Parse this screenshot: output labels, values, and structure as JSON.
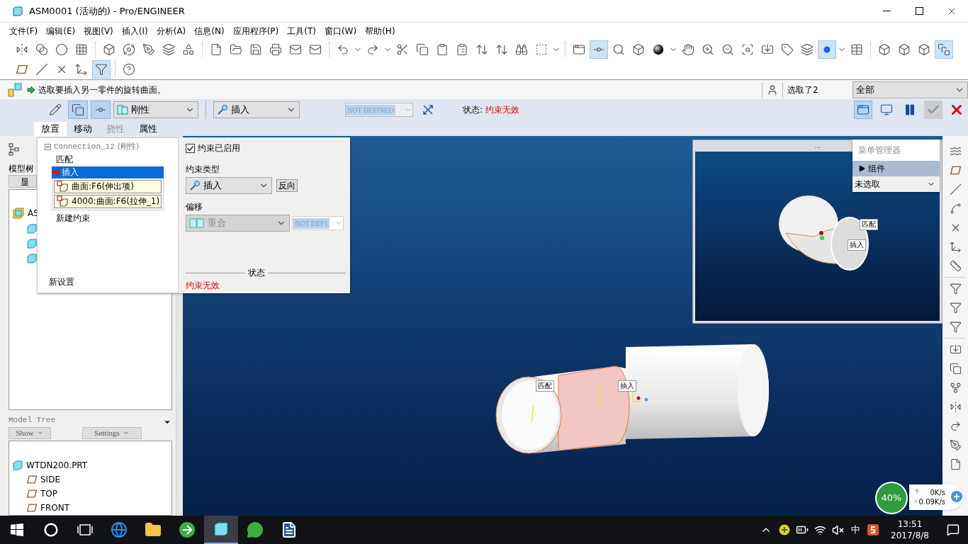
{
  "window": {
    "title": "ASM0001 (活动的) - Pro/ENGINEER"
  },
  "menu": [
    "文件(F)",
    "编辑(E)",
    "视图(V)",
    "插入(I)",
    "分析(A)",
    "信息(N)",
    "应用程序(P)",
    "工具(T)",
    "窗口(W)",
    "帮助(H)"
  ],
  "toolbar_rows": [
    [
      [
        {
          "kind": "flip",
          "selected": false,
          "dropdown": false
        },
        {
          "kind": "blend",
          "selected": false,
          "dropdown": false
        },
        {
          "kind": "circle",
          "selected": false,
          "dropdown": false
        },
        {
          "kind": "grid",
          "selected": false,
          "dropdown": false
        }
      ],
      [
        {
          "kind": "box",
          "selected": false,
          "dropdown": false
        },
        {
          "kind": "orbit",
          "selected": false,
          "dropdown": false
        },
        {
          "kind": "pen",
          "selected": false,
          "dropdown": false
        },
        {
          "kind": "layers",
          "selected": false,
          "dropdown": false
        },
        {
          "kind": "shapes",
          "selected": false,
          "dropdown": false
        }
      ],
      [
        {
          "kind": "file",
          "selected": false,
          "dropdown": false
        },
        {
          "kind": "folder",
          "selected": false,
          "dropdown": false
        },
        {
          "kind": "save",
          "selected": false,
          "dropdown": false
        },
        {
          "kind": "printer",
          "selected": false,
          "dropdown": false
        },
        {
          "kind": "mail",
          "selected": false,
          "dropdown": false
        },
        {
          "kind": "mail",
          "selected": false,
          "dropdown": false
        }
      ],
      [
        {
          "kind": "undo",
          "selected": false,
          "dropdown": true
        },
        {
          "kind": "redo",
          "selected": false,
          "dropdown": true
        },
        {
          "kind": "scissors",
          "selected": false,
          "dropdown": false
        },
        {
          "kind": "copy",
          "selected": false,
          "dropdown": false
        },
        {
          "kind": "clipboard",
          "selected": false,
          "dropdown": false
        },
        {
          "kind": "clipboard-list",
          "selected": false,
          "dropdown": false
        },
        {
          "kind": "arrows",
          "selected": false,
          "dropdown": false
        },
        {
          "kind": "arrows",
          "selected": false,
          "dropdown": false
        },
        {
          "kind": "binoculars",
          "selected": false,
          "dropdown": false
        },
        {
          "kind": "dashed",
          "selected": false,
          "dropdown": true
        }
      ],
      [
        {
          "kind": "window",
          "selected": false,
          "dropdown": false
        },
        {
          "kind": "connector",
          "selected": true,
          "dropdown": false
        },
        {
          "kind": "search",
          "selected": false,
          "dropdown": false
        },
        {
          "kind": "box",
          "selected": false,
          "dropdown": false
        },
        {
          "kind": "sphere",
          "selected": false,
          "dropdown": true
        },
        {
          "kind": "hand",
          "selected": false,
          "dropdown": false
        },
        {
          "kind": "zoom-in",
          "selected": false,
          "dropdown": false
        },
        {
          "kind": "zoom-out",
          "selected": false,
          "dropdown": false
        },
        {
          "kind": "scan",
          "selected": false,
          "dropdown": false
        },
        {
          "kind": "import",
          "selected": false,
          "dropdown": false
        },
        {
          "kind": "tag",
          "selected": false,
          "dropdown": false
        },
        {
          "kind": "layers",
          "selected": false,
          "dropdown": false
        },
        {
          "kind": "dot",
          "selected": true,
          "dropdown": true
        },
        {
          "kind": "table",
          "selected": false,
          "dropdown": false
        }
      ],
      [
        {
          "kind": "box",
          "selected": false,
          "dropdown": false
        },
        {
          "kind": "box",
          "selected": false,
          "dropdown": false
        },
        {
          "kind": "box",
          "selected": false,
          "dropdown": false
        },
        {
          "kind": "shaded-box",
          "selected": true,
          "dropdown": false
        }
      ]
    ],
    [
      [
        {
          "kind": "plane",
          "selected": false,
          "dropdown": false
        },
        {
          "kind": "slash",
          "selected": false,
          "dropdown": false
        },
        {
          "kind": "points",
          "selected": false,
          "dropdown": false
        },
        {
          "kind": "axes",
          "selected": false,
          "dropdown": false
        },
        {
          "kind": "filter",
          "selected": true,
          "dropdown": false
        }
      ],
      [
        {
          "kind": "help",
          "selected": false,
          "dropdown": false
        }
      ]
    ]
  ],
  "message": {
    "text": "选取要插入另一零件的旋转曲面。"
  },
  "selection": {
    "count": "选取了2",
    "filter": "全部"
  },
  "dashboard": {
    "tools": [
      {
        "kind": "edit",
        "selected": false
      },
      {
        "kind": "copy",
        "selected": true
      },
      {
        "kind": "connector",
        "selected": true
      }
    ],
    "connection_type": "刚性",
    "constraint_type": "插入",
    "offset_value": "NOT DEFINED",
    "status_label": "状态:",
    "status": "约束无效",
    "actions": [
      {
        "kind": "window",
        "selected": true,
        "disabled": false
      },
      {
        "kind": "preview",
        "selected": false,
        "disabled": false
      },
      {
        "kind": "pause",
        "selected": false,
        "disabled": false
      },
      {
        "kind": "ok",
        "selected": false,
        "disabled": true
      },
      {
        "kind": "cancel",
        "selected": false,
        "disabled": false
      }
    ],
    "tabs": [
      {
        "label": "放置",
        "selected": true,
        "disabled": false
      },
      {
        "label": "移动",
        "selected": false,
        "disabled": false
      },
      {
        "label": "挠性",
        "selected": false,
        "disabled": true
      },
      {
        "label": "属性",
        "selected": false,
        "disabled": false
      }
    ]
  },
  "placement": {
    "connection": {
      "label": "Connection_12",
      "type": "(刚性)",
      "expanded": true
    },
    "constraints": [
      {
        "label": "匹配",
        "selected": false
      },
      {
        "label": "插入",
        "selected": true
      }
    ],
    "references": [
      "曲面:F6(伸出项)",
      "4000:曲面:F6(拉伸_1)"
    ],
    "new_constraint": "新建约束",
    "new_set": "新设置",
    "enabled": {
      "label": "约束已启用",
      "checked": true
    },
    "type_label": "约束类型",
    "type_value": "插入",
    "flip": "反向",
    "offset_label": "偏移",
    "offset_mode": "重合",
    "offset_value": "NOT DEF1",
    "status_title": "状态",
    "status": "约束无效"
  },
  "model_tree": {
    "tab_label": "模型树",
    "show_button": "显",
    "root": "AS"
  },
  "part_tree": {
    "title": "Model Tree",
    "show": "Show",
    "settings": "Settings",
    "root": "WTDN200.PRT",
    "children": [
      {
        "label": "SIDE"
      },
      {
        "label": "TOP"
      },
      {
        "label": "FRONT"
      }
    ]
  },
  "viewport": {
    "labels": [
      "匹配",
      "插入"
    ]
  },
  "mini_window": {
    "title": "...",
    "labels": [
      "匹配",
      "插入"
    ]
  },
  "menu_manager": {
    "title": "菜单管理器",
    "items": [
      {
        "label": "组件",
        "selected": true
      }
    ],
    "dropdown": "未选取"
  },
  "right_toolbar": [
    [
      {
        "kind": "waves"
      },
      {
        "kind": "plane"
      },
      {
        "kind": "slash"
      },
      {
        "kind": "spline"
      },
      {
        "kind": "points"
      },
      {
        "kind": "axes"
      },
      {
        "kind": "ruler"
      }
    ],
    [
      {
        "kind": "filter"
      },
      {
        "kind": "filter"
      },
      {
        "kind": "filter"
      }
    ],
    [
      {
        "kind": "import"
      },
      {
        "kind": "copy"
      },
      {
        "kind": "fork"
      },
      {
        "kind": "flip"
      },
      {
        "kind": "redo"
      },
      {
        "kind": "pen"
      },
      {
        "kind": "file"
      }
    ]
  ],
  "taskbar": {
    "apps": [
      {
        "kind": "cortana",
        "selected": false
      },
      {
        "kind": "taskview",
        "selected": false
      },
      {
        "kind": "edge",
        "selected": false
      },
      {
        "kind": "folder",
        "selected": false
      },
      {
        "kind": "browser",
        "selected": false
      },
      {
        "kind": "proe",
        "selected": true
      },
      {
        "kind": "chat",
        "selected": false
      },
      {
        "kind": "word",
        "selected": false
      }
    ],
    "ime": "中",
    "time": "13:51",
    "date": "2017/8/8"
  },
  "network_widget": {
    "percent": "40%",
    "up": "0K/s",
    "down": "0.09K/s"
  }
}
